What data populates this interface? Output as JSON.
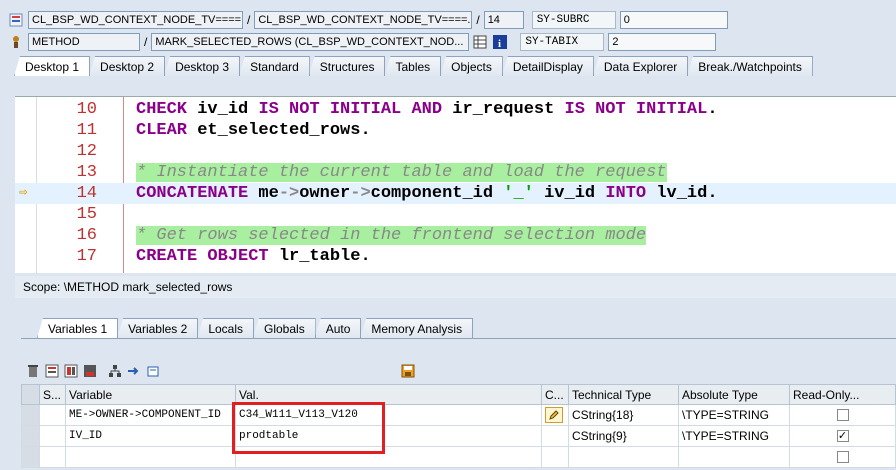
{
  "header": {
    "row1": {
      "class_field": "CL_BSP_WD_CONTEXT_NODE_TV====...",
      "class_field2": "CL_BSP_WD_CONTEXT_NODE_TV====...",
      "line": "14",
      "sysvar_label": "SY-SUBRC",
      "sysvar_value": "0"
    },
    "row2": {
      "type_field": "METHOD",
      "method_field": "MARK_SELECTED_ROWS (CL_BSP_WD_CONTEXT_NOD...",
      "sysvar_label": "SY-TABIX",
      "sysvar_value": "2"
    }
  },
  "tabs": [
    "Desktop 1",
    "Desktop 2",
    "Desktop 3",
    "Standard",
    "Structures",
    "Tables",
    "Objects",
    "DetailDisplay",
    "Data Explorer",
    "Break./Watchpoints"
  ],
  "code": [
    {
      "num": "10",
      "parts": [
        [
          "kw",
          "CHECK "
        ],
        [
          "id",
          "iv_id "
        ],
        [
          "kw",
          "IS NOT INITIAL AND "
        ],
        [
          "id",
          "ir_request "
        ],
        [
          "kw",
          "IS NOT INITIAL"
        ],
        [
          "id",
          "."
        ]
      ]
    },
    {
      "num": "11",
      "parts": [
        [
          "kw",
          "CLEAR "
        ],
        [
          "id",
          "et_selected_rows."
        ]
      ]
    },
    {
      "num": "12",
      "parts": []
    },
    {
      "num": "13",
      "parts": [
        [
          "cm",
          "* Instantiate the current table and load the request"
        ]
      ]
    },
    {
      "num": "14",
      "parts": [
        [
          "kw",
          "CONCATENATE "
        ],
        [
          "id",
          "me"
        ],
        [
          "op",
          "->"
        ],
        [
          "id",
          "owner"
        ],
        [
          "op",
          "->"
        ],
        [
          "id",
          "component_id "
        ],
        [
          "str",
          "'_' "
        ],
        [
          "id",
          "iv_id "
        ],
        [
          "kw",
          "INTO "
        ],
        [
          "id",
          "lv_id."
        ]
      ]
    },
    {
      "num": "15",
      "parts": []
    },
    {
      "num": "16",
      "parts": [
        [
          "cm",
          "* Get rows selected in the frontend selection mode"
        ]
      ]
    },
    {
      "num": "17",
      "parts": [
        [
          "kw",
          "CREATE OBJECT "
        ],
        [
          "id",
          "lr_table."
        ]
      ]
    }
  ],
  "scope": "Scope: \\METHOD mark_selected_rows",
  "var_tabs": [
    "Variables 1",
    "Variables 2",
    "Locals",
    "Globals",
    "Auto",
    "Memory Analysis"
  ],
  "table": {
    "headers": [
      "S...",
      "Variable",
      "Val.",
      "C...",
      "Technical Type",
      "Absolute Type",
      "Read-Only..."
    ],
    "rows": [
      {
        "variable": "ME->OWNER->COMPONENT_ID",
        "value": "C34_W111_V113_V120",
        "tech": "CString{18}",
        "abs": "\\TYPE=STRING",
        "readonly": false
      },
      {
        "variable": "IV_ID",
        "value": "prodtable",
        "tech": "CString{9}",
        "abs": "\\TYPE=STRING",
        "readonly": true
      },
      {
        "variable": "",
        "value": "",
        "tech": "",
        "abs": "",
        "readonly": false
      }
    ]
  }
}
